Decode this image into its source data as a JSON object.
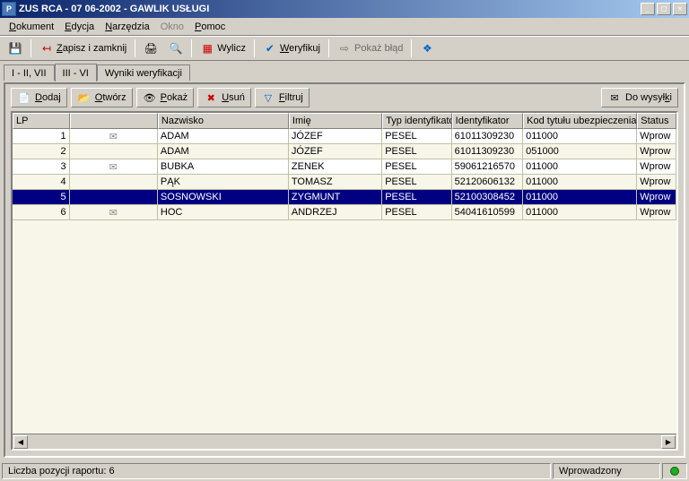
{
  "titlebar": {
    "text": "ZUS RCA - 07 06-2002 - GAWLIK USŁUGI"
  },
  "menubar": [
    {
      "label": "Dokument",
      "mn": "D"
    },
    {
      "label": "Edycja",
      "mn": "E"
    },
    {
      "label": "Narzędzia",
      "mn": "N"
    },
    {
      "label": "Okno",
      "mn": "",
      "disabled": true
    },
    {
      "label": "Pomoc",
      "mn": "P"
    }
  ],
  "toolbar": {
    "save_close": "Zapisz i zamknij",
    "wylicz": "Wylicz",
    "weryfikuj": "Weryfikuj",
    "pokaz_blad": "Pokaż błąd"
  },
  "tabs": {
    "t1": "I - II, VII",
    "t2": "III - VI",
    "t3": "Wyniki weryfikacji"
  },
  "content_toolbar": {
    "dodaj": "Dodaj",
    "otworz": "Otwórz",
    "pokaz": "Pokaż",
    "usun": "Usuń",
    "filtruj": "Filtruj",
    "do_wysylki": "Do wysyłki"
  },
  "grid": {
    "headers": {
      "lp": "LP",
      "env": "",
      "nazwisko": "Nazwisko",
      "imie": "Imię",
      "typ": "Typ identyfikatora",
      "ident": "Identyfikator",
      "kod": "Kod tytułu ubezpieczenia",
      "status": "Status"
    },
    "rows": [
      {
        "lp": "1",
        "env": true,
        "nazwisko": "ADAM",
        "imie": "JÓZEF",
        "typ": "PESEL",
        "ident": "61011309230",
        "kod": "011000",
        "status": "Wprow"
      },
      {
        "lp": "2",
        "env": false,
        "nazwisko": "ADAM",
        "imie": "JÓZEF",
        "typ": "PESEL",
        "ident": "61011309230",
        "kod": "051000",
        "status": "Wprow"
      },
      {
        "lp": "3",
        "env": true,
        "nazwisko": "BUBKA",
        "imie": "ZENEK",
        "typ": "PESEL",
        "ident": "59061216570",
        "kod": "011000",
        "status": "Wprow"
      },
      {
        "lp": "4",
        "env": false,
        "nazwisko": "PĄK",
        "imie": "TOMASZ",
        "typ": "PESEL",
        "ident": "52120606132",
        "kod": "011000",
        "status": "Wprow"
      },
      {
        "lp": "5",
        "env": false,
        "nazwisko": "SOSNOWSKI",
        "imie": "ZYGMUNT",
        "typ": "PESEL",
        "ident": "52100308452",
        "kod": "011000",
        "status": "Wprow",
        "selected": true
      },
      {
        "lp": "6",
        "env": true,
        "nazwisko": "HOC",
        "imie": "ANDRZEJ",
        "typ": "PESEL",
        "ident": "54041610599",
        "kod": "011000",
        "status": "Wprow"
      }
    ]
  },
  "statusbar": {
    "count_text": "Liczba pozycji raportu: 6",
    "status_text": "Wprowadzony"
  }
}
